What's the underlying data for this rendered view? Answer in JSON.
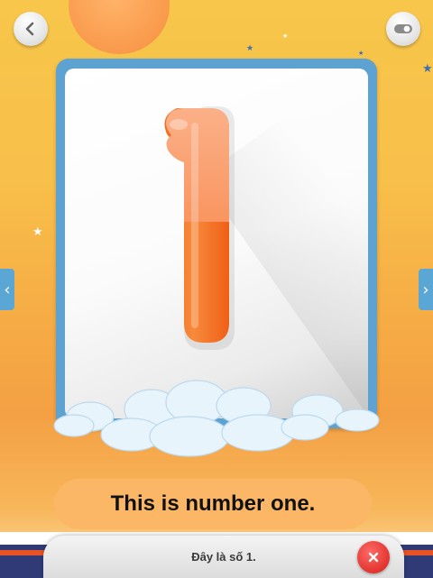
{
  "lesson": {
    "number_glyph": "1",
    "caption": "This is number one.",
    "subtitle": "Đây là số 1."
  },
  "nav": {
    "back_icon": "chevron-left-icon",
    "settings_icon": "toggle-icon",
    "prev_icon": "chevron-left-icon",
    "next_icon": "chevron-right-icon",
    "close_icon": "close-icon",
    "prev_glyph": "‹",
    "next_glyph": "›"
  },
  "colors": {
    "accent_orange": "#f26b21",
    "frame_blue": "#5ea2d1",
    "close_red": "#e0302b",
    "bubble": "#fbb766"
  }
}
